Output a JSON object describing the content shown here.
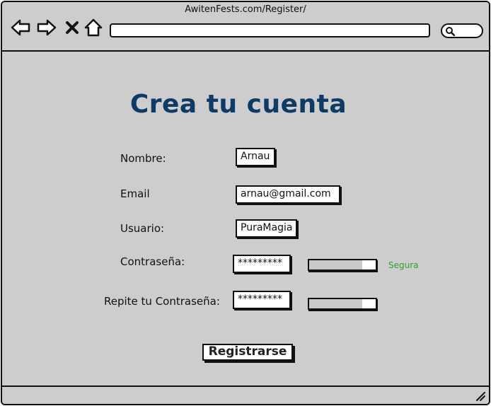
{
  "browser": {
    "url": "AwitenFests.com/Register/",
    "icons": {
      "back": "back-arrow-icon",
      "forward": "forward-arrow-icon",
      "stop": "close-icon",
      "home": "home-icon",
      "search": "search-icon",
      "resize": "resize-grip-icon"
    }
  },
  "form": {
    "title": "Crea tu cuenta",
    "fields": {
      "nombre": {
        "label": "Nombre:",
        "value": "Arnau"
      },
      "email": {
        "label": "Email",
        "value": "arnau@gmail.com"
      },
      "usuario": {
        "label": "Usuario:",
        "value": "PuraMagia"
      },
      "password": {
        "label": "Contraseña:",
        "value": "*********"
      },
      "password_repeat": {
        "label": "Repite tu Contraseña:",
        "value": "*********"
      }
    },
    "strength": {
      "label": "Segura",
      "color": "#2ca52c",
      "password_fill": 0.8,
      "repeat_fill": 0.8
    },
    "submit_label": "Registrarse"
  },
  "colors": {
    "title": "#0d3a66",
    "window_bg": "#cdcdcd"
  }
}
